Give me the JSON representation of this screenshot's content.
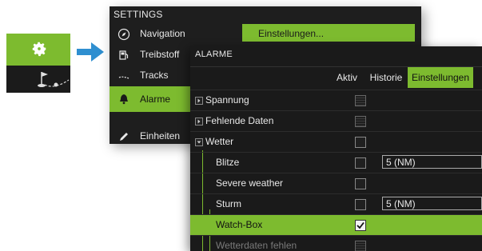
{
  "settings": {
    "title": "SETTINGS",
    "items": [
      {
        "label": "Navigation",
        "icon": "compass-icon"
      },
      {
        "label": "Treibstoff",
        "icon": "fuel-icon"
      },
      {
        "label": "Tracks",
        "icon": "tracks-icon"
      },
      {
        "label": "Alarme",
        "icon": "bell-icon",
        "active": true
      },
      {
        "label": "Einheiten",
        "icon": "pencil-icon"
      }
    ],
    "detail": "Einstellungen..."
  },
  "alarm": {
    "title": "ALARME",
    "tabs": [
      "Aktiv",
      "Historie",
      "Einstellungen"
    ],
    "active_tab": "Einstellungen",
    "rows": [
      {
        "label": "Spannung",
        "expander": "collapsed",
        "checkbox": "disabled"
      },
      {
        "label": "Fehlende Daten",
        "expander": "collapsed",
        "checkbox": "disabled"
      },
      {
        "label": "Wetter",
        "expander": "expanded",
        "checkbox": "unchecked"
      },
      {
        "label": "Blitze",
        "checkbox": "unchecked",
        "value": "5 (NM)"
      },
      {
        "label": "Severe weather",
        "checkbox": "unchecked"
      },
      {
        "label": "Sturm",
        "checkbox": "unchecked",
        "value": "5 (NM)"
      },
      {
        "label": "Watch-Box",
        "checkbox": "checked",
        "selected": true
      },
      {
        "label": "Wetterdaten fehlen",
        "checkbox": "disabled"
      }
    ]
  },
  "colors": {
    "accent": "#7dbb2f",
    "panel": "#1e1e1e",
    "arrow": "#2f8fd0"
  }
}
